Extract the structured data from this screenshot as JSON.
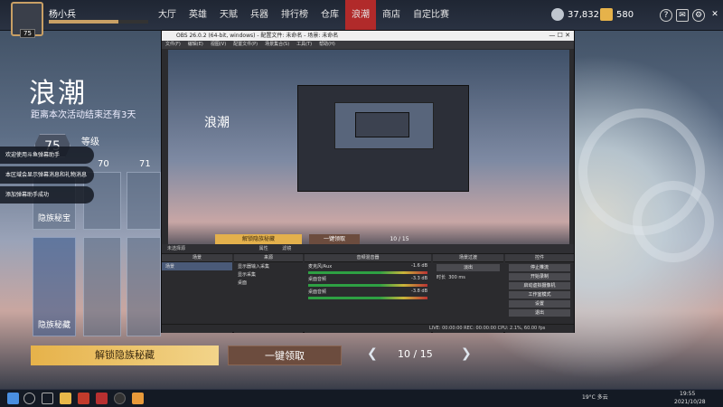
{
  "topbar": {
    "username": "杨小兵",
    "avatar_level": "75",
    "nav_tabs": [
      {
        "label": "大厅",
        "active": false,
        "badge": false
      },
      {
        "label": "英雄",
        "active": false,
        "badge": true
      },
      {
        "label": "天赋",
        "active": false,
        "badge": true
      },
      {
        "label": "兵器",
        "active": false,
        "badge": false
      },
      {
        "label": "排行榜",
        "active": false,
        "badge": false
      },
      {
        "label": "仓库",
        "active": false,
        "badge": true
      },
      {
        "label": "浪潮",
        "active": true,
        "badge": false
      },
      {
        "label": "商店",
        "active": false,
        "badge": false
      },
      {
        "label": "自定比赛",
        "active": false,
        "badge": false
      }
    ],
    "currency_1": "37,832",
    "currency_2": "580",
    "icons": [
      "help-icon",
      "mail-icon",
      "settings-icon",
      "minimize-icon",
      "close-icon"
    ]
  },
  "event": {
    "title": "浪潮",
    "subtitle": "距离本次活动结束还有3天",
    "level_current": "75",
    "level_label": "等级",
    "level_numbers": [
      "70",
      "71"
    ],
    "card_labels": [
      "隐族秘宝",
      "隐族秘藏"
    ],
    "unlock_button": "解锁隐族秘藏",
    "claim_button": "一键领取",
    "pager": "10 / 15"
  },
  "chat_notices": [
    "欢迎使用斗鱼弹幕助手",
    "本区域会显示弹幕消息和礼物消息",
    "添加弹幕助手成功"
  ],
  "obs": {
    "window_title": "OBS 26.0.2 (64-bit, windows) - 配置文件: 未命名 - 场景: 未命名",
    "menu": [
      "文件(F)",
      "编辑(E)",
      "视图(V)",
      "配置文件(P)",
      "场景集合(S)",
      "工具(T)",
      "帮助(H)"
    ],
    "preview_title": "浪潮",
    "preview_buttons": [
      "解锁隐族秘藏",
      "一键领取"
    ],
    "preview_pager": "10 / 15",
    "dock_strip": "未选择源",
    "dock_strip_buttons": [
      "属性",
      "滤镜"
    ],
    "scenes_header": "场景",
    "scenes": [
      "场景"
    ],
    "sources_header": "来源",
    "sources": [
      "显示器输入采集",
      "显示采集",
      "桌面"
    ],
    "mixer_header": "音频混音器",
    "mixer_channels": [
      {
        "name": "麦克风/Aux",
        "db": "-1.6 dB"
      },
      {
        "name": "桌面音频",
        "db": "-3.3 dB"
      },
      {
        "name": "桌面音频",
        "db": "-3.8 dB"
      }
    ],
    "transitions_header": "场景过渡",
    "transition_type": "淡出",
    "duration_label": "时长",
    "duration_value": "300 ms",
    "controls_header": "控件",
    "controls": [
      "停止推流",
      "开始录制",
      "启动虚拟摄像机",
      "工作室模式",
      "设置",
      "退出"
    ],
    "status": "LIVE: 00:00:00   REC: 00:00:00   CPU: 2.1%, 60.00 fps"
  },
  "taskbar": {
    "weather": "19°C 多云",
    "time": "19:55",
    "date": "2021/10/28"
  }
}
